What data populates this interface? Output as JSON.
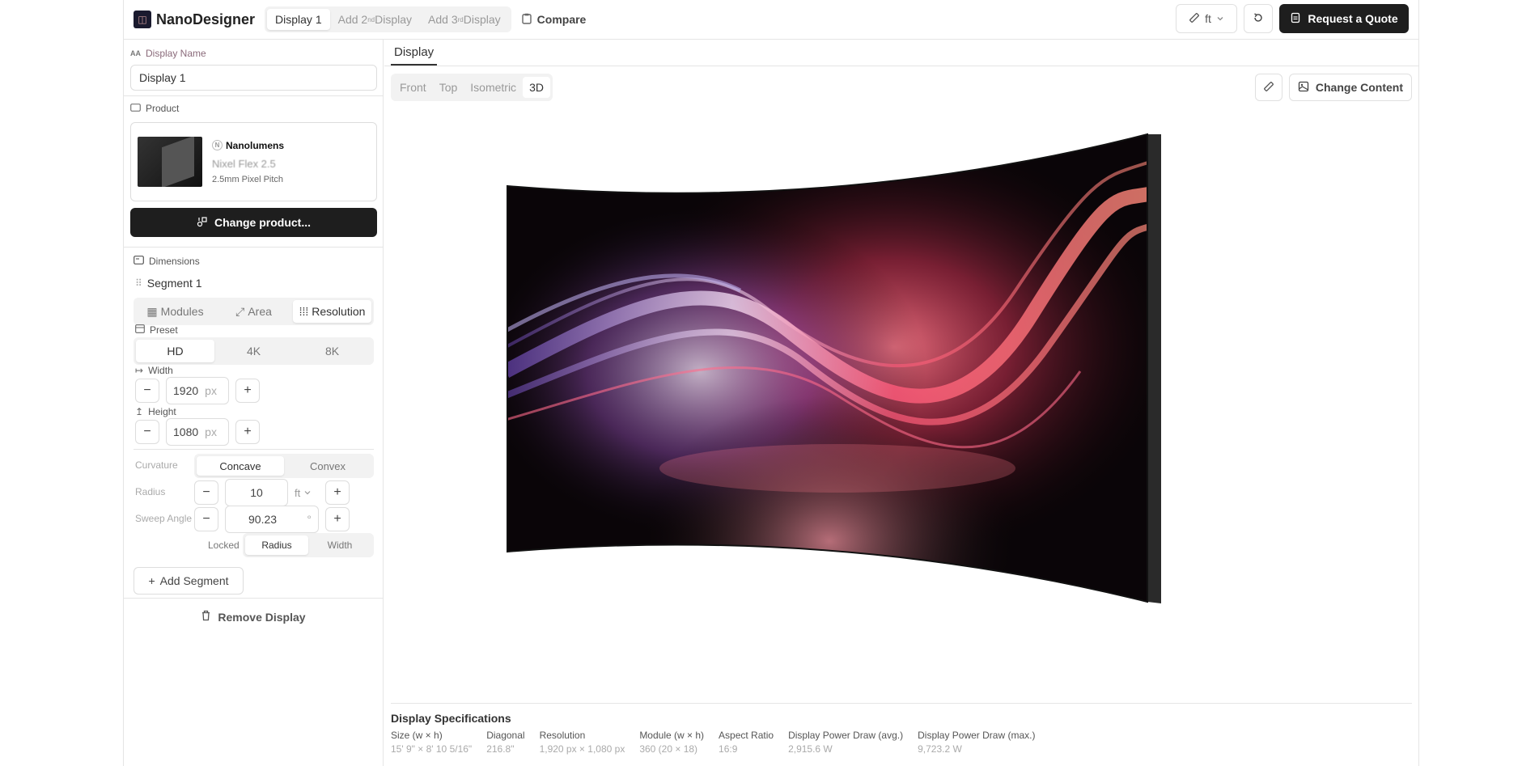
{
  "header": {
    "brand": "NanoDesigner",
    "tabs": [
      {
        "label": "Display 1"
      },
      {
        "pre": "Add 2",
        "sup": "nd",
        "post": " Display"
      },
      {
        "pre": "Add 3",
        "sup": "rd",
        "post": " Display"
      }
    ],
    "compare": "Compare",
    "unit": "ft",
    "quote": "Request a Quote"
  },
  "sidebar": {
    "display_name_label": "Display Name",
    "display_name_value": "Display 1",
    "product_label": "Product",
    "product": {
      "brand": "Nanolumens",
      "name": "Nixel Flex 2.5",
      "pitch": "2.5mm Pixel Pitch"
    },
    "change_product": "Change product...",
    "dimensions_label": "Dimensions",
    "segment_label": "Segment 1",
    "modes": [
      "Modules",
      "Area",
      "Resolution"
    ],
    "preset_label": "Preset",
    "presets": [
      "HD",
      "4K",
      "8K"
    ],
    "width_label": "Width",
    "width_value": "1920",
    "height_label": "Height",
    "height_value": "1080",
    "px": "px",
    "curvature_label": "Curvature",
    "curvature_opts": [
      "Concave",
      "Convex"
    ],
    "radius_label": "Radius",
    "radius_value": "10",
    "radius_unit": "ft",
    "sweep_label": "Sweep Angle",
    "sweep_value": "90.23",
    "sweep_unit": "°",
    "locked_label": "Locked",
    "locked_opts": [
      "Radius",
      "Width"
    ],
    "add_segment": "Add Segment",
    "remove_display": "Remove Display"
  },
  "main": {
    "tab": "Display",
    "views": [
      "Front",
      "Top",
      "Isometric",
      "3D"
    ],
    "change_content": "Change Content",
    "specs_title": "Display Specifications",
    "specs": [
      {
        "k": "Size (w × h)",
        "v": "15' 9\" × 8' 10 5/16\""
      },
      {
        "k": "Diagonal",
        "v": "216.8\""
      },
      {
        "k": "Resolution",
        "v": "1,920 px × 1,080 px"
      },
      {
        "k": "Module (w × h)",
        "v": "360 (20 × 18)"
      },
      {
        "k": "Aspect Ratio",
        "v": "16:9"
      },
      {
        "k": "Display Power Draw (avg.)",
        "v": "2,915.6 W"
      },
      {
        "k": "Display Power Draw (max.)",
        "v": "9,723.2 W"
      }
    ]
  },
  "colors": {
    "accent": "#1e1e1e",
    "muted_label": "#8a6a7a"
  }
}
